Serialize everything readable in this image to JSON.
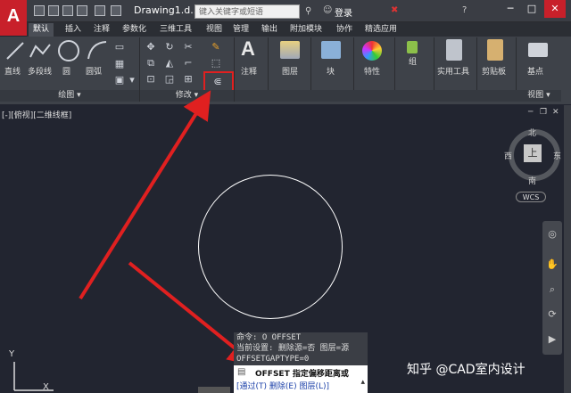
{
  "app": {
    "logo": "A",
    "title": "Drawing1.d...",
    "search_placeholder": "键入关键字或短语",
    "login": "登录"
  },
  "tabs": [
    "默认",
    "插入",
    "注释",
    "参数化",
    "三维工具",
    "视图",
    "管理",
    "输出",
    "附加模块",
    "协作",
    "精选应用"
  ],
  "draw_panel": {
    "items": [
      "直线",
      "多段线",
      "圆",
      "圆弧"
    ],
    "footer": "绘图"
  },
  "modify_panel": {
    "footer": "修改"
  },
  "big_buttons": [
    "注释",
    "图层",
    "块",
    "特性",
    "组",
    "实用工具",
    "剪贴板",
    "基点"
  ],
  "view_footer": "视图",
  "viewport_label": "[-][俯视][二维线框]",
  "compass": {
    "north": "北",
    "south": "南",
    "east": "东",
    "west": "西",
    "center": "上",
    "wcs": "WCS"
  },
  "command": {
    "history": [
      "命令: O OFFSET",
      "当前设置: 删除源=否  图层=源",
      "  OFFSETGAPTYPE=0"
    ],
    "prompt": "OFFSET 指定偏移距离或",
    "options": "[通过(T) 删除(E) 图层(L)]"
  },
  "ucs": {
    "y": "Y",
    "x": "X"
  },
  "watermark": "知乎 @CAD室内设计",
  "colors": {
    "accent": "#c8202a",
    "highlight": "#e02020",
    "canvas": "#222530"
  }
}
